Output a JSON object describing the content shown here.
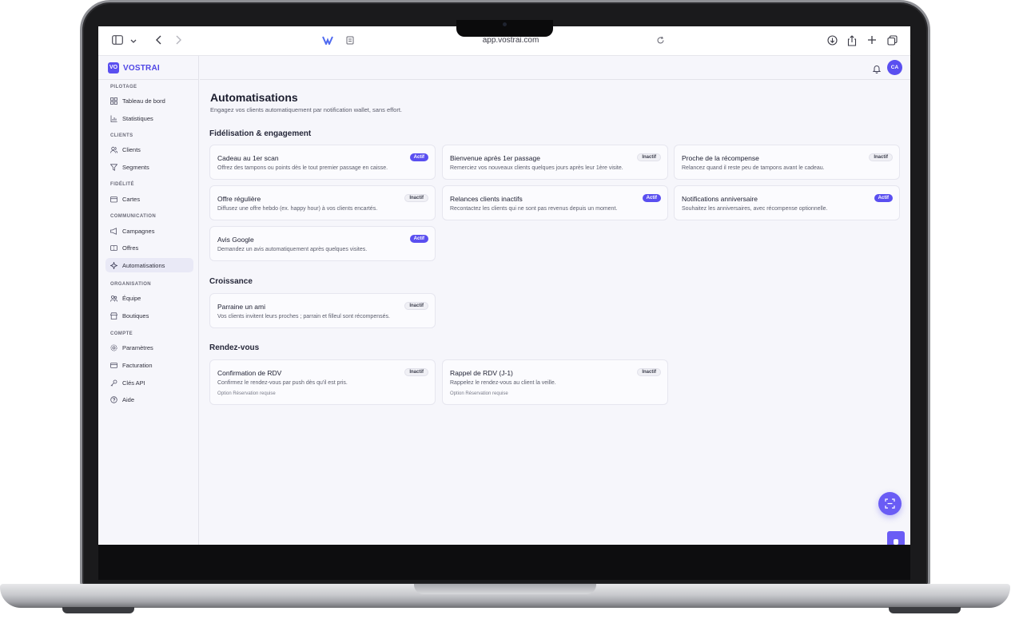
{
  "browser": {
    "url": "app.vostrai.com"
  },
  "brand": {
    "logo_text": "VO",
    "name": "VOSTRAI",
    "accent": "#5a4ff0"
  },
  "user": {
    "initials": "CA"
  },
  "sidebar": {
    "sections": [
      {
        "label": "PILOTAGE",
        "items": [
          {
            "label": "Tableau de bord",
            "icon": "dashboard-icon"
          },
          {
            "label": "Statistiques",
            "icon": "chart-icon"
          }
        ]
      },
      {
        "label": "CLIENTS",
        "items": [
          {
            "label": "Clients",
            "icon": "users-icon"
          },
          {
            "label": "Segments",
            "icon": "filter-icon"
          }
        ]
      },
      {
        "label": "FIDÉLITÉ",
        "items": [
          {
            "label": "Cartes",
            "icon": "card-icon"
          }
        ]
      },
      {
        "label": "COMMUNICATION",
        "items": [
          {
            "label": "Campagnes",
            "icon": "megaphone-icon"
          },
          {
            "label": "Offres",
            "icon": "ticket-icon"
          },
          {
            "label": "Automatisations",
            "icon": "sparkle-icon",
            "active": true
          }
        ]
      },
      {
        "label": "ORGANISATION",
        "items": [
          {
            "label": "Équipe",
            "icon": "team-icon"
          },
          {
            "label": "Boutiques",
            "icon": "store-icon"
          }
        ]
      },
      {
        "label": "COMPTE",
        "items": [
          {
            "label": "Paramètres",
            "icon": "gear-icon"
          },
          {
            "label": "Facturation",
            "icon": "billing-icon"
          },
          {
            "label": "Clés API",
            "icon": "key-icon"
          },
          {
            "label": "Aide",
            "icon": "help-icon"
          }
        ]
      }
    ]
  },
  "main": {
    "title": "Automatisations",
    "subtitle": "Engagez vos clients automatiquement par notification wallet, sans effort.",
    "sections": [
      {
        "title": "Fidélisation & engagement",
        "cards": [
          {
            "title": "Cadeau au 1er scan",
            "desc": "Offrez des tampons ou points dès le tout premier passage en caisse.",
            "status": "Actif"
          },
          {
            "title": "Bienvenue après 1er passage",
            "desc": "Remerciez vos nouveaux clients quelques jours après leur 1ère visite.",
            "status": "Inactif"
          },
          {
            "title": "Proche de la récompense",
            "desc": "Relancez quand il reste peu de tampons avant le cadeau.",
            "status": "Inactif"
          },
          {
            "title": "Offre régulière",
            "desc": "Diffusez une offre hebdo (ex. happy hour) à vos clients encartés.",
            "status": "Inactif"
          },
          {
            "title": "Relances clients inactifs",
            "desc": "Recontactez les clients qui ne sont pas revenus depuis un moment.",
            "status": "Actif"
          },
          {
            "title": "Notifications anniversaire",
            "desc": "Souhaitez les anniversaires, avec récompense optionnelle.",
            "status": "Actif"
          },
          {
            "title": "Avis Google",
            "desc": "Demandez un avis automatiquement après quelques visites.",
            "status": "Actif"
          }
        ]
      },
      {
        "title": "Croissance",
        "cards": [
          {
            "title": "Parraine un ami",
            "desc": "Vos clients invitent leurs proches ; parrain et filleul sont récompensés.",
            "status": "Inactif"
          }
        ]
      },
      {
        "title": "Rendez-vous",
        "cards": [
          {
            "title": "Confirmation de RDV",
            "desc": "Confirmez le rendez-vous par push dès qu'il est pris.",
            "option": "Option Réservation requise",
            "status": "Inactif"
          },
          {
            "title": "Rappel de RDV (J-1)",
            "desc": "Rappelez le rendez-vous au client la veille.",
            "option": "Option Réservation requise",
            "status": "Inactif"
          }
        ]
      }
    ]
  },
  "colors": {
    "active_badge": "#5a4ff0",
    "background": "#f6f6fb"
  }
}
